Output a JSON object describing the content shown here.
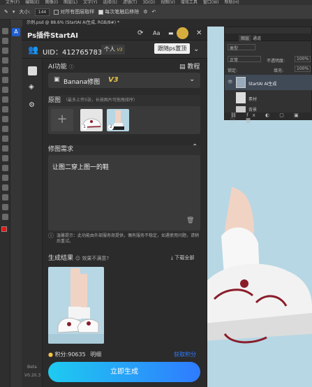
{
  "menubar": [
    "文件(F)",
    "编辑(E)",
    "图像(I)",
    "图层(L)",
    "文字(Y)",
    "选择(S)",
    "滤镜(T)",
    "3D(D)",
    "视图(V)",
    "增效工具",
    "窗口(W)",
    "帮助(H)"
  ],
  "options": {
    "size_label": "大小:",
    "size_value": "144",
    "sample_all": "对所有图层取样",
    "auto_enhance": "每次笔触后移除"
  },
  "doc_tab": "示例.psd @ 88.6% (StartAI AI生成, RGB/8#) *",
  "plugin": {
    "title": "Ps插件StartAI",
    "tooltip": "跟随ps置顶",
    "uid": "UID：4127657838",
    "account": "个人",
    "vip": "V3",
    "ai_function_label": "AI功能",
    "tutorial_label": "教程",
    "model": "Banana修图",
    "model_version": "V3",
    "original_label": "原图",
    "original_hint": "（最多上传5张，长按图片可拖拽排序）",
    "images": [
      {
        "index": "1"
      },
      {
        "index": "2"
      }
    ],
    "requirement_label": "修图需求",
    "requirement_text": "让图二穿上图一的鞋",
    "notice": "温馨提示：此功能由外部服务商提供，偶有服务不稳定，如遇使用问题，请稍后重试。",
    "result_label": "生成结果",
    "unsatisfied": "效果不满意?",
    "download_all": "下载全部",
    "points": "积分:90635",
    "detail": "明细",
    "get_points": "获取积分",
    "generate": "立即生成",
    "beta": "Beta",
    "version": "V0.20.3"
  },
  "layers": {
    "tabs": [
      "图层",
      "通道"
    ],
    "kind": "类型",
    "blend": "正常",
    "opacity_label": "不透明度:",
    "opacity": "100%",
    "lock_label": "锁定:",
    "fill_label": "填充:",
    "fill": "100%",
    "items": [
      "StartAI AI生成",
      "素材",
      "背景"
    ]
  },
  "colors": {
    "accent": "#2f7bff",
    "vip": "#e6c34a",
    "highlight": "#f5c542",
    "bg": "#2b2b2b"
  }
}
